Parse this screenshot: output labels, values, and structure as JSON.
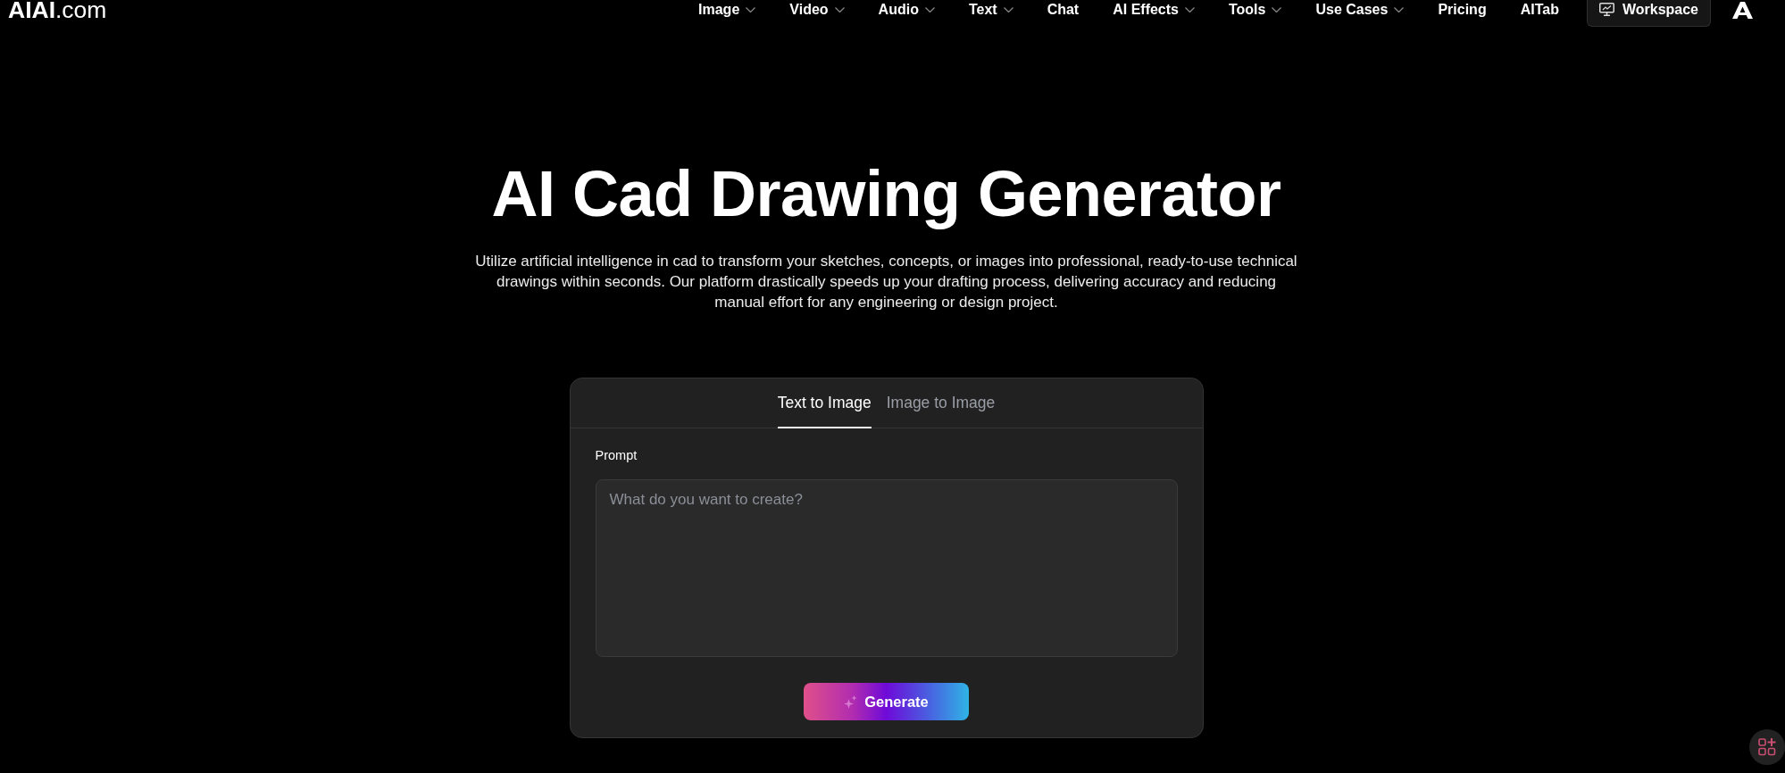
{
  "header": {
    "logo": "**AIAI**.com",
    "nav": [
      {
        "label": "Image",
        "has_dropdown": true
      },
      {
        "label": "Video",
        "has_dropdown": true
      },
      {
        "label": "Audio",
        "has_dropdown": true
      },
      {
        "label": "Text",
        "has_dropdown": true
      },
      {
        "label": "Chat",
        "has_dropdown": false
      },
      {
        "label": "AI Effects",
        "has_dropdown": true
      },
      {
        "label": "Tools",
        "has_dropdown": true
      },
      {
        "label": "Use Cases",
        "has_dropdown": true
      },
      {
        "label": "Pricing",
        "has_dropdown": false
      },
      {
        "label": "AITab",
        "has_dropdown": false
      }
    ],
    "workspace_button": "Workspace"
  },
  "hero": {
    "title": "AI Cad Drawing Generator",
    "description": "Utilize artificial intelligence in cad to transform your sketches, concepts, or images into professional, ready-to-use technical drawings within seconds. Our platform drastically speeds up your drafting process, delivering accuracy and reducing manual effort for any engineering or design project."
  },
  "generator": {
    "tabs": [
      {
        "label": "Text to Image",
        "selected": true
      },
      {
        "label": "Image to Image",
        "selected": false
      }
    ],
    "prompt": {
      "label": "Prompt",
      "placeholder": "What do you want to create?"
    },
    "generate_button": "Generate"
  }
}
